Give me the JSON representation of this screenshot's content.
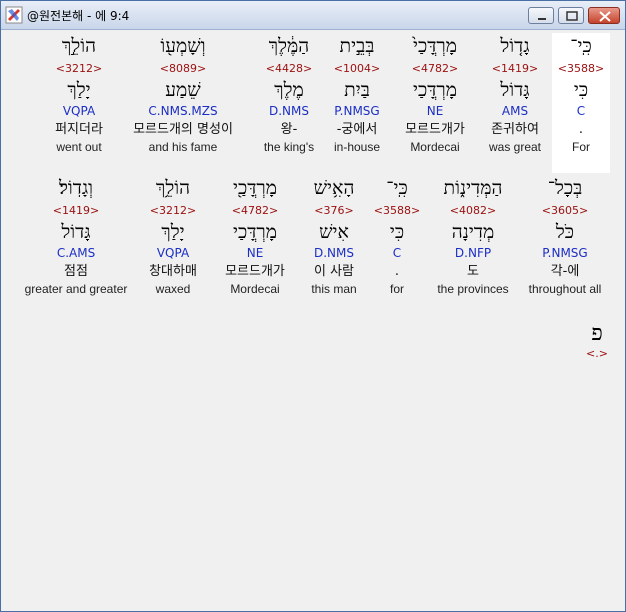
{
  "window": {
    "title": "@원전본해 - 에 9:4",
    "buttons": {
      "minimize": "minimize",
      "maximize": "maximize",
      "close": "close"
    }
  },
  "rows": [
    {
      "words": [
        {
          "hebrew": "כִּֽי־",
          "strongs": "<3588>",
          "lemma": "כִּי",
          "morph": "C",
          "korean": ".",
          "english": "For",
          "highlight": true
        },
        {
          "hebrew": "גָד֤וֹל",
          "strongs": "<1419>",
          "lemma": "גָּדוֹל",
          "morph": "AMS",
          "korean": "존귀하여",
          "english": "was great",
          "highlight": false
        },
        {
          "hebrew": "מָרְדֳּכַי֙",
          "strongs": "<4782>",
          "lemma": "מָרְדֳּכַי",
          "morph": "NE",
          "korean": "모르드개가",
          "english": "Mordecai",
          "highlight": false
        },
        {
          "hebrew": "בְּבֵ֣ית",
          "strongs": "<1004>",
          "lemma": "בַּיִת",
          "morph": "P.NMSG",
          "korean": "-궁에서",
          "english": "in-house",
          "highlight": false
        },
        {
          "hebrew": "הַמֶּ֔לֶךְ",
          "strongs": "<4428>",
          "lemma": "מֶלֶךְ",
          "morph": "D.NMS",
          "korean": "왕-",
          "english": "the king's",
          "highlight": false
        },
        {
          "hebrew": "וְשָׁמְע֖וֹ",
          "strongs": "<8089>",
          "lemma": "שֵׁמַע",
          "morph": "C.NMS.MZS",
          "korean": "모르드개의 명성이",
          "english": "and his fame",
          "highlight": false
        },
        {
          "hebrew": "הוֹלֵ֣ךְ",
          "strongs": "<3212>",
          "lemma": "יָלַךְ",
          "morph": "VQPA",
          "korean": "퍼지더라",
          "english": "went out",
          "highlight": false
        }
      ]
    },
    {
      "words": [
        {
          "hebrew": "בְּכָל־",
          "strongs": "<3605>",
          "lemma": "כֹּל",
          "morph": "P.NMSG",
          "korean": "각-에",
          "english": "throughout all",
          "highlight": false
        },
        {
          "hebrew": "הַמְּדִינ֑וֹת",
          "strongs": "<4082>",
          "lemma": "מְדִינָה",
          "morph": "D.NFP",
          "korean": "도",
          "english": "the provinces",
          "highlight": false
        },
        {
          "hebrew": "כִּֽי־",
          "strongs": "<3588>",
          "lemma": "כִּי",
          "morph": "C",
          "korean": ".",
          "english": "for",
          "highlight": false
        },
        {
          "hebrew": "הָאִ֥ישׁ",
          "strongs": "<376>",
          "lemma": "אִישׁ",
          "morph": "D.NMS",
          "korean": "이 사람",
          "english": "this man",
          "highlight": false
        },
        {
          "hebrew": "מָרְדֳּכַ֖י",
          "strongs": "<4782>",
          "lemma": "מָרְדֳּכַי",
          "morph": "NE",
          "korean": "모르드개가",
          "english": "Mordecai",
          "highlight": false
        },
        {
          "hebrew": "הוֹלֵ֥ךְ",
          "strongs": "<3212>",
          "lemma": "יָלַךְ",
          "morph": "VQPA",
          "korean": "창대하매",
          "english": "waxed",
          "highlight": false
        },
        {
          "hebrew": "וְגָדֽוֹל׃",
          "strongs": "<1419>",
          "lemma": "גָּדוֹל",
          "morph": "C.AMS",
          "korean": "점점",
          "english": "greater and greater",
          "highlight": false
        }
      ]
    }
  ],
  "paragraph_marker": {
    "glyph": "פ",
    "code": "<.>"
  }
}
